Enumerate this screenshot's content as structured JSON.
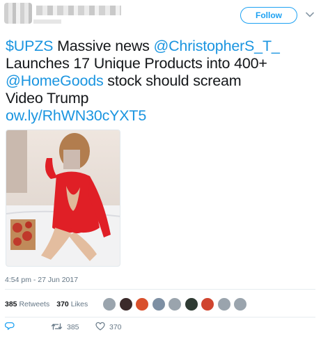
{
  "header": {
    "follow_label": "Follow",
    "caret_icon": "chevron-down-icon"
  },
  "tweet": {
    "lines": [
      [
        {
          "text": "$UPZS",
          "link": true
        },
        {
          "text": " Massive news ",
          "link": false
        },
        {
          "text": "@ChristopherS_T_",
          "link": true
        }
      ],
      [
        {
          "text": "Launches 17 Unique Products into 400+",
          "link": false
        }
      ],
      [
        {
          "text": "@HomeGoods",
          "link": true
        },
        {
          "text": " stock should scream",
          "link": false
        }
      ],
      [
        {
          "text": "Video Trump",
          "link": false
        }
      ],
      [
        {
          "text": "ow.ly/RhWN30cYXT5",
          "link": true
        }
      ]
    ],
    "timestamp": "4:54 pm - 27 Jun 2017"
  },
  "stats": {
    "retweets_count": "385",
    "retweets_label": "Retweets",
    "likes_count": "370",
    "likes_label": "Likes"
  },
  "likers": [
    {
      "color": "#9aa4ad"
    },
    {
      "color": "#3b2a2a"
    },
    {
      "color": "#d9502c"
    },
    {
      "color": "#7d8fa3"
    },
    {
      "color": "#9aa4ad"
    },
    {
      "color": "#2f3b33"
    },
    {
      "color": "#d0452f"
    },
    {
      "color": "#9aa4ad"
    },
    {
      "color": "#9aa4ad"
    }
  ],
  "actions": {
    "reply_icon": "reply-icon",
    "retweet_icon": "retweet-icon",
    "retweet_count": "385",
    "like_icon": "heart-icon",
    "like_count": "370"
  },
  "colors": {
    "link": "#1b95e0",
    "follow": "#1da1f2",
    "muted": "#657786"
  }
}
